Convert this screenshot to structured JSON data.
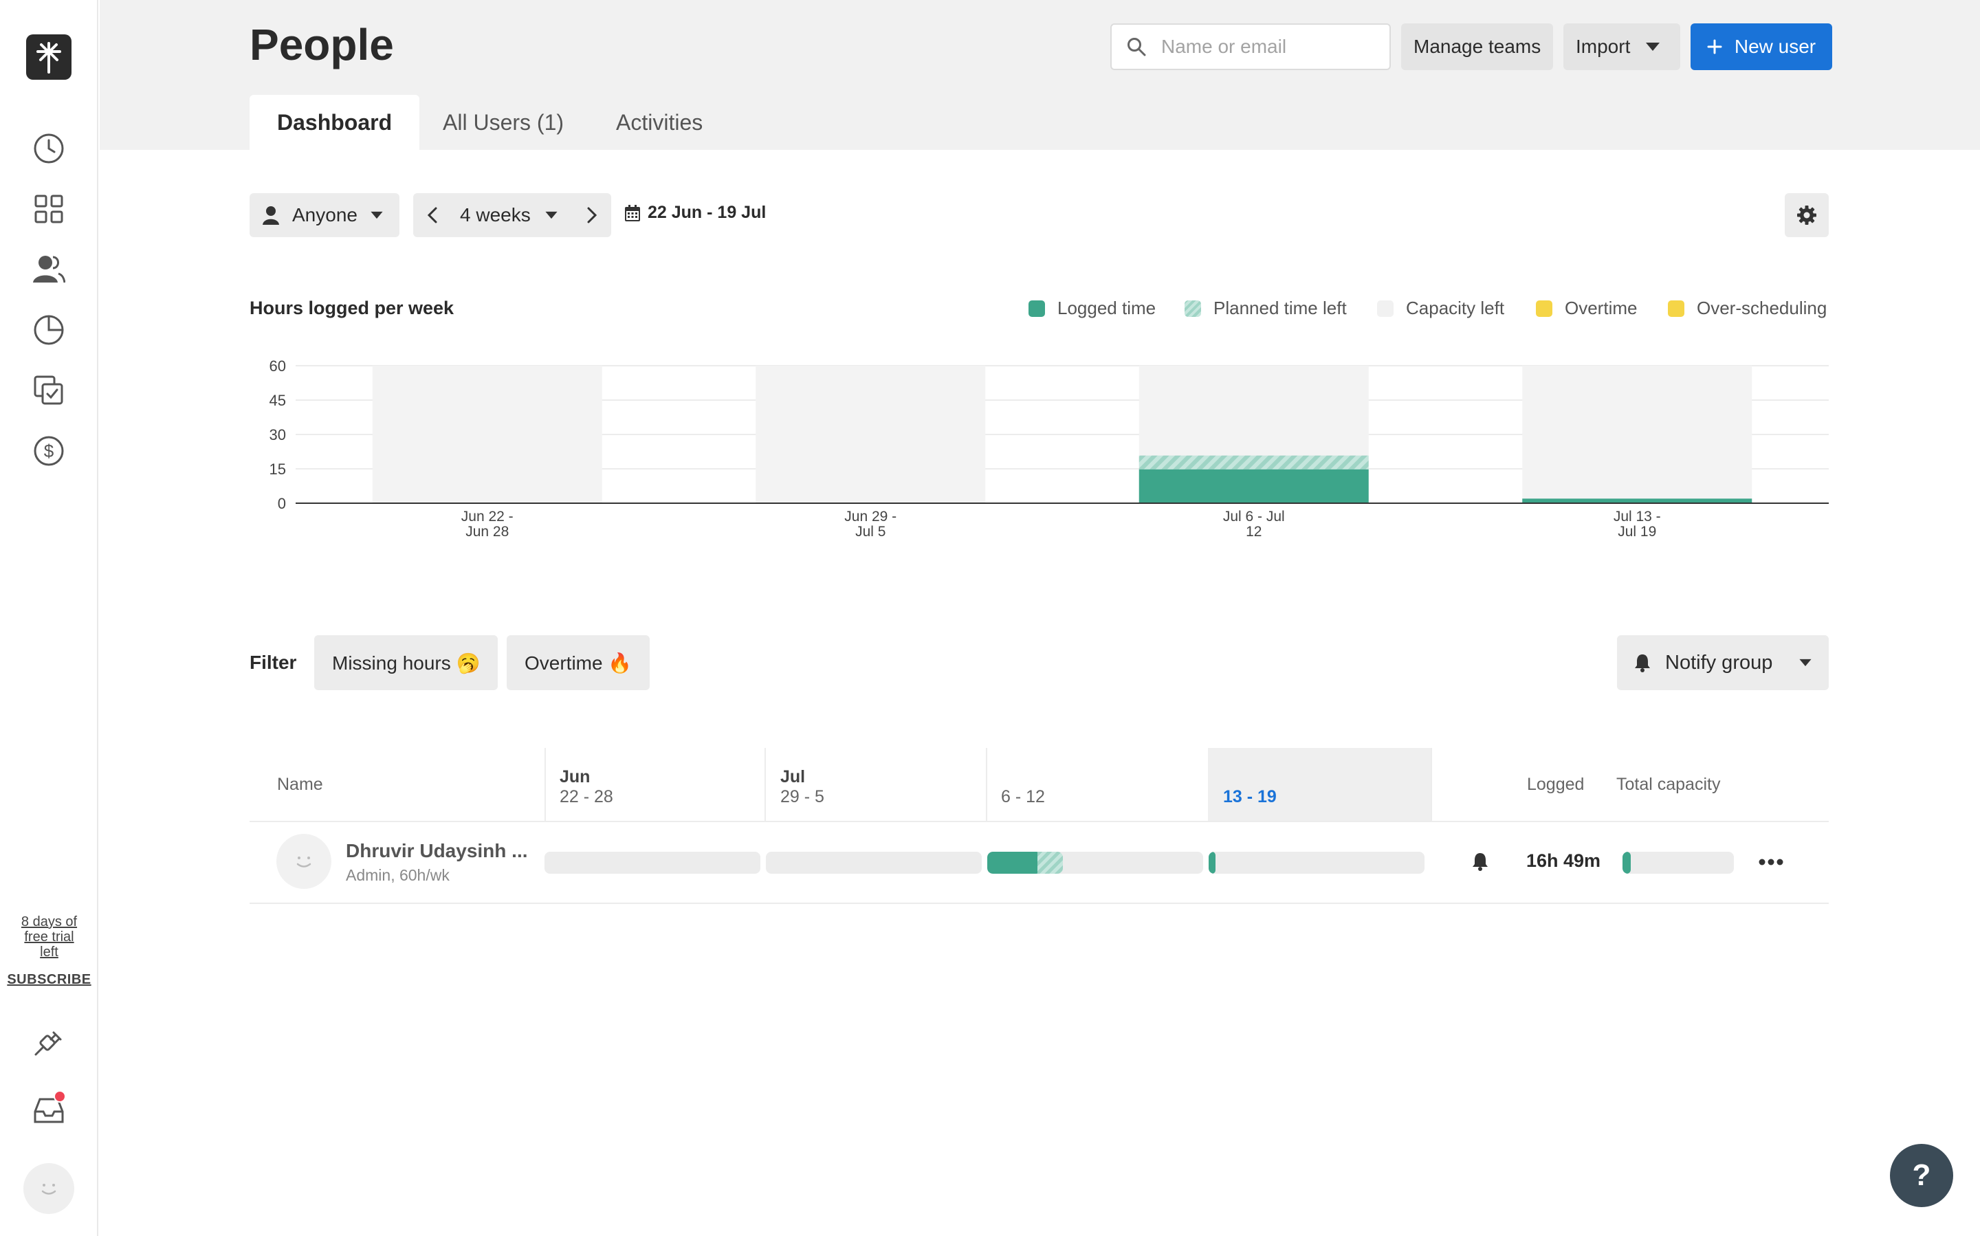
{
  "sidebar": {
    "trial_lines": [
      "8 days of",
      "free trial",
      "left"
    ],
    "subscribe": "SUBSCRIBE"
  },
  "header": {
    "title": "People",
    "search_placeholder": "Name or email",
    "manage_teams": "Manage teams",
    "import": "Import",
    "new_user": "New user",
    "tabs": [
      "Dashboard",
      "All Users (1)",
      "Activities"
    ]
  },
  "controls": {
    "person_filter": "Anyone",
    "period": "4 weeks",
    "date_range": "22 Jun - 19 Jul"
  },
  "chart_section": {
    "title": "Hours logged per week",
    "legend": [
      {
        "label": "Logged time",
        "color": "#3da58a"
      },
      {
        "label": "Planned time left",
        "color": "#9fd4c5"
      },
      {
        "label": "Capacity left",
        "color": "#f1f1f1"
      },
      {
        "label": "Overtime",
        "color": "#f5d547"
      },
      {
        "label": "Over-scheduling",
        "color": "#f5d547"
      }
    ]
  },
  "chart_data": {
    "type": "bar",
    "title": "Hours logged per week",
    "categories": [
      [
        "Jun 22 -",
        "Jun 28"
      ],
      [
        "Jun 29 -",
        "Jul 5"
      ],
      [
        "Jul 6 - Jul",
        "12"
      ],
      [
        "Jul 13 -",
        "Jul 19"
      ]
    ],
    "y_ticks": [
      0,
      15,
      30,
      45,
      60
    ],
    "ylim": [
      0,
      60
    ],
    "series": [
      {
        "name": "Logged time",
        "values": [
          0,
          0,
          14.8,
          2
        ]
      },
      {
        "name": "Planned time left",
        "values": [
          0,
          0,
          6,
          0
        ]
      },
      {
        "name": "Capacity left",
        "values": [
          60,
          60,
          39.2,
          58
        ]
      }
    ]
  },
  "filter": {
    "label": "Filter",
    "missing_hours": "Missing hours 🥱",
    "overtime": "Overtime 🔥",
    "notify_group": "Notify group"
  },
  "table": {
    "col_name": "Name",
    "weeks": [
      {
        "month": "Jun",
        "range": "22 - 28"
      },
      {
        "month": "Jul",
        "range": "29 - 5"
      },
      {
        "month": "",
        "range": "6 - 12"
      },
      {
        "month": "",
        "range": "13 - 19"
      }
    ],
    "col_logged": "Logged",
    "col_capacity": "Total capacity",
    "rows": [
      {
        "name": "Dhruvir Udaysinh ...",
        "sub": "Admin, 60h/wk",
        "logged": "16h 49m",
        "week_fill": [
          {
            "logged": 0,
            "planned": 0
          },
          {
            "logged": 0,
            "planned": 0
          },
          {
            "logged": 0.25,
            "planned": 0.1
          },
          {
            "logged": 0.03,
            "planned": 0
          }
        ],
        "capacity_fill": 0.07
      }
    ]
  },
  "help": "?"
}
